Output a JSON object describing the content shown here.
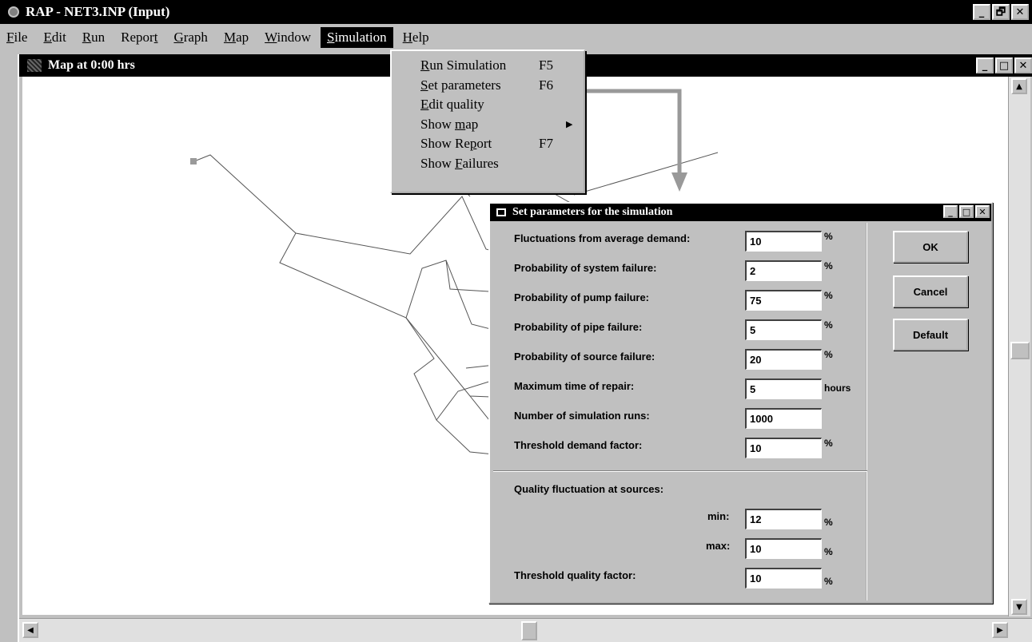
{
  "app": {
    "title": "RAP - NET3.INP (Input)",
    "window_buttons": [
      "_",
      "🗗",
      "✕"
    ]
  },
  "menu": [
    {
      "key": "F",
      "rest": "ile"
    },
    {
      "key": "E",
      "rest": "dit"
    },
    {
      "key": "R",
      "rest": "un"
    },
    {
      "pre": "Repor",
      "key": "t",
      "rest": ""
    },
    {
      "key": "G",
      "rest": "raph"
    },
    {
      "key": "M",
      "rest": "ap"
    },
    {
      "key": "W",
      "rest": "indow"
    },
    {
      "key": "S",
      "rest": "imulation"
    },
    {
      "key": "H",
      "rest": "elp"
    }
  ],
  "child_window": {
    "title": "Map at 0:00 hrs",
    "buttons": [
      "_",
      "□",
      "✕"
    ]
  },
  "simulation_menu": [
    {
      "key": "R",
      "rest": "un Simulation",
      "accel": "F5"
    },
    {
      "key": "S",
      "rest": "et parameters",
      "accel": "F6"
    },
    {
      "key": "E",
      "rest": "dit quality",
      "accel": ""
    },
    {
      "pre": "Show ",
      "key": "m",
      "rest": "ap",
      "accel": "",
      "submenu_icon": "chevron-right-icon"
    },
    {
      "pre": "Show Re",
      "key": "p",
      "rest": "ort",
      "accel": "F7"
    },
    {
      "pre": "Show ",
      "key": "F",
      "rest": "ailures",
      "accel": ""
    }
  ],
  "dialog": {
    "title": "Set parameters for the simulation",
    "fields": [
      {
        "label": "Fluctuations from average demand:",
        "value": "10",
        "unit": "%"
      },
      {
        "label": "Probability of system failure:",
        "value": "2",
        "unit": "%"
      },
      {
        "label": "Probability of pump failure:",
        "value": "75",
        "unit": "%"
      },
      {
        "label": "Probability of pipe failure:",
        "value": "5",
        "unit": "%"
      },
      {
        "label": "Probability of source failure:",
        "value": "20",
        "unit": "%"
      },
      {
        "label": "Maximum time of repair:",
        "value": "5",
        "unit": "hours"
      },
      {
        "label": "Number of simulation runs:",
        "value": "1000",
        "unit": ""
      },
      {
        "label": "Threshold demand factor:",
        "value": "10",
        "unit": "%"
      }
    ],
    "quality": {
      "heading": "Quality fluctuation at sources:",
      "min_label": "min:",
      "min_value": "12",
      "max_label": "max:",
      "max_value": "10",
      "unit": "%",
      "threshold_label": "Threshold quality factor:",
      "threshold_value": "10"
    },
    "buttons": {
      "ok": "OK",
      "cancel": "Cancel",
      "default": "Default"
    }
  },
  "colors": {
    "titlebar": "#000000",
    "face": "#c0c0c0",
    "callout_arrow": "#999999",
    "node": "#9a9a9a"
  }
}
